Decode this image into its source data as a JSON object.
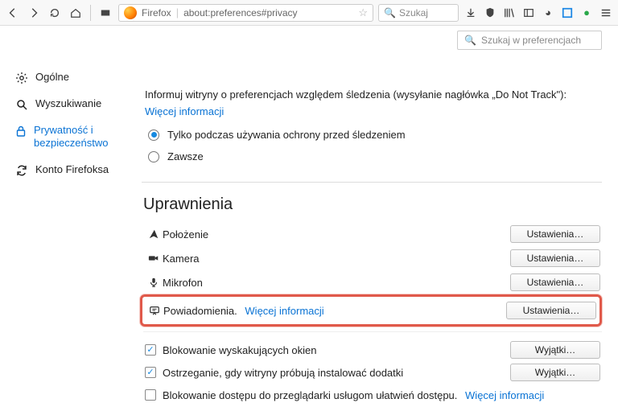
{
  "toolbar": {
    "firefox_label": "Firefox",
    "url": "about:preferences#privacy",
    "search_placeholder": "Szukaj"
  },
  "content_search_placeholder": "Szukaj w preferencjach",
  "sidebar": {
    "items": [
      {
        "label": "Ogólne"
      },
      {
        "label": "Wyszukiwanie"
      },
      {
        "label": "Prywatność i bezpieczeństwo"
      },
      {
        "label": "Konto Firefoksa"
      }
    ]
  },
  "tracking": {
    "intro": "Informuj witryny o preferencjach względem śledzenia (wysyłanie nagłówka „Do Not Track\"):",
    "more_info": "Więcej informacji",
    "options": [
      "Tylko podczas używania ochrony przed śledzeniem",
      "Zawsze"
    ]
  },
  "permissions": {
    "heading": "Uprawnienia",
    "settings_label": "Ustawienia…",
    "items": [
      {
        "label": "Położenie"
      },
      {
        "label": "Kamera"
      },
      {
        "label": "Mikrofon"
      },
      {
        "label": "Powiadomienia.",
        "more_info": "Więcej informacji"
      }
    ]
  },
  "checkboxes": {
    "exceptions_label": "Wyjątki…",
    "items": [
      {
        "label": "Blokowanie wyskakujących okien",
        "checked": true,
        "has_button": true
      },
      {
        "label": "Ostrzeganie, gdy witryny próbują instalować dodatki",
        "checked": true,
        "has_button": true
      },
      {
        "label": "Blokowanie dostępu do przeglądarki usługom ułatwień dostępu.",
        "checked": false,
        "has_button": false,
        "more_info": "Więcej informacji"
      }
    ]
  }
}
